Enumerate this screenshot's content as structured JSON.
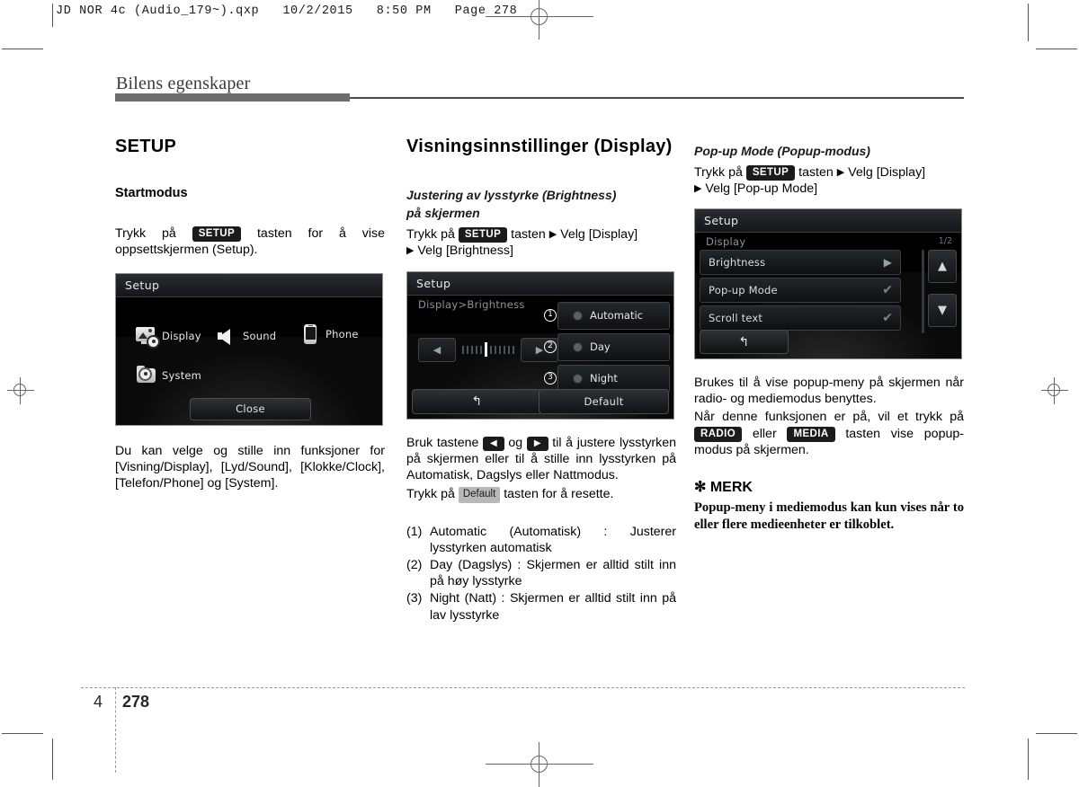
{
  "prepress": {
    "filebar": "JD NOR 4c (Audio_179~).qxp   10/2/2015   8:50 PM   Page 278"
  },
  "chapter": {
    "title": "Bilens egenskaper",
    "number": "4",
    "page": "278"
  },
  "col1": {
    "section_title": "SETUP",
    "sub_title": "Startmodus",
    "intro_pre": "Trykk på",
    "key_setup": "SETUP",
    "intro_post": "tasten for å vise oppsettskjermen (Setup).",
    "screen": {
      "title": "Setup",
      "items": [
        {
          "label": "Display",
          "icon": "display-gear-icon"
        },
        {
          "label": "Sound",
          "icon": "speaker-icon"
        },
        {
          "label": "Phone",
          "icon": "phone-icon"
        },
        {
          "label": "System",
          "icon": "folder-gear-icon"
        }
      ],
      "close_label": "Close"
    },
    "caption": "Du kan velge og stille inn funksjoner for [Visning/Display], [Lyd/Sound], [Klokke/Clock], [Telefon/Phone] og [System]."
  },
  "col2": {
    "section_title": "Visningsinnstillinger (Display)",
    "sub_title_line1": "Justering av lysstyrke (Brightness)",
    "sub_title_line2": "på skjermen",
    "path_pre": "Trykk på",
    "key_setup": "SETUP",
    "path_mid": "tasten",
    "path_1": "Velg [Display]",
    "path_2": "Velg [Brightness]",
    "screen": {
      "title": "Setup",
      "breadcrumb": "Display>Brightness",
      "slider": {
        "ticks": 12,
        "active_index": 6
      },
      "options": [
        {
          "num": "1",
          "label": "Automatic"
        },
        {
          "num": "2",
          "label": "Day"
        },
        {
          "num": "3",
          "label": "Night"
        }
      ],
      "back_label": "back-arrow",
      "default_label": "Default"
    },
    "body_pre": "Bruk tastene",
    "body_mid": "og",
    "body_post": "til å justere lysstyrken på skjermen eller til å stille inn lysstyrken på Automatisk, Dagslys eller Nattmodus.",
    "reset_pre": "Trykk på",
    "key_default": "Default",
    "reset_post": "tasten for å resette.",
    "list": [
      {
        "n": "(1)",
        "text": "Automatic (Automatisk) : Justerer lysstyrken automatisk"
      },
      {
        "n": "(2)",
        "text": "Day (Dagslys) : Skjermen er alltid stilt inn på høy lysstyrke"
      },
      {
        "n": "(3)",
        "text": "Night (Natt) : Skjermen er alltid stilt inn på lav lysstyrke"
      }
    ]
  },
  "col3": {
    "sub_title": "Pop-up Mode (Popup-modus)",
    "path_pre": "Trykk på",
    "key_setup": "SETUP",
    "path_mid": "tasten",
    "path_1": "Velg [Display]",
    "path_2": "Velg [Pop-up Mode]",
    "screen": {
      "title": "Setup",
      "breadcrumb": "Display",
      "page_indicator": "1/2",
      "rows": [
        {
          "label": "Brightness",
          "indicator": "arrow"
        },
        {
          "label": "Pop-up Mode",
          "indicator": "check"
        },
        {
          "label": "Scroll text",
          "indicator": "check"
        }
      ],
      "back_label": "back-arrow",
      "scroll_up": "up-arrow",
      "scroll_down": "down-arrow"
    },
    "body_1": "Brukes til å vise popup-meny på skjermen når radio- og mediemodus benyttes.",
    "body_2_pre": "Når denne funksjonen er på, vil et trykk på",
    "key_radio": "RADIO",
    "body_2_mid": "eller",
    "key_media": "MEDIA",
    "body_2_post": "tasten vise popup-modus på skjermen.",
    "note_title": "✻ MERK",
    "note_body": "Popup-meny i mediemodus kan kun vises når to eller flere medieenheter er tilkoblet."
  }
}
